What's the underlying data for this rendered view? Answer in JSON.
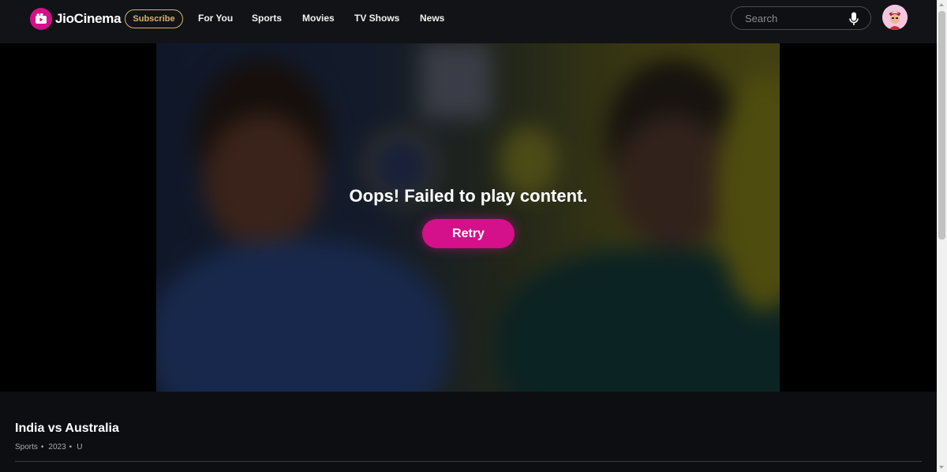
{
  "header": {
    "logo_text": "JioCinema",
    "subscribe_label": "Subscribe",
    "nav": [
      "For You",
      "Sports",
      "Movies",
      "TV Shows",
      "News"
    ],
    "search_placeholder": "Search",
    "brand_color": "#d4108a",
    "subscribe_color": "#d8b36a"
  },
  "player": {
    "error_message": "Oops! Failed to play content.",
    "retry_label": "Retry"
  },
  "content": {
    "title": "India vs Australia",
    "meta": [
      "Sports",
      "2023",
      "U"
    ]
  },
  "icons": {
    "logo": "jiocinema-logo-icon",
    "mic": "mic-icon",
    "avatar": "avatar"
  }
}
